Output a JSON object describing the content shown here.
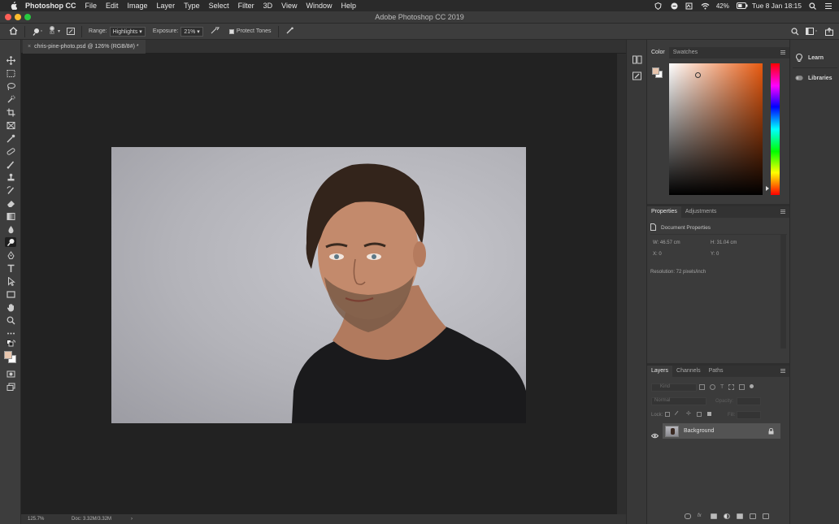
{
  "menubar": {
    "app_name": "Photoshop CC",
    "menus": [
      "File",
      "Edit",
      "Image",
      "Layer",
      "Type",
      "Select",
      "Filter",
      "3D",
      "View",
      "Window",
      "Help"
    ],
    "battery": "42%",
    "clock": "Tue 8 Jan  18:15"
  },
  "window": {
    "title": "Adobe Photoshop CC 2019"
  },
  "options": {
    "brush_size": "83",
    "range_label": "Range:",
    "range_value": "Highlights",
    "exposure_label": "Exposure:",
    "exposure_value": "21%",
    "protect_tones": "Protect Tones"
  },
  "document": {
    "tab_title": "chris-pine-photo.psd @ 126% (RGB/8#) *",
    "zoom": "125.7%",
    "doc_size": "Doc: 3.32M/3.32M"
  },
  "color_panel": {
    "tabs": [
      "Color",
      "Swatches"
    ],
    "fg_color": "#e8c6ae",
    "bg_color": "#ffffff"
  },
  "properties_panel": {
    "tabs": [
      "Properties",
      "Adjustments"
    ],
    "heading": "Document Properties",
    "w": "W:  46.57 cm",
    "h": "H:  31.04 cm",
    "x": "X:  0",
    "y": "Y:  0",
    "resolution": "Resolution: 72 pixels/inch"
  },
  "layers_panel": {
    "tabs": [
      "Layers",
      "Channels",
      "Paths"
    ],
    "search": "Kind",
    "blend_mode": "Normal",
    "opacity_label": "Opacity:",
    "lock_label": "Lock:",
    "fill_label": "Fill:",
    "layer_name": "Background"
  },
  "right_strip": {
    "learn": "Learn",
    "libraries": "Libraries"
  }
}
